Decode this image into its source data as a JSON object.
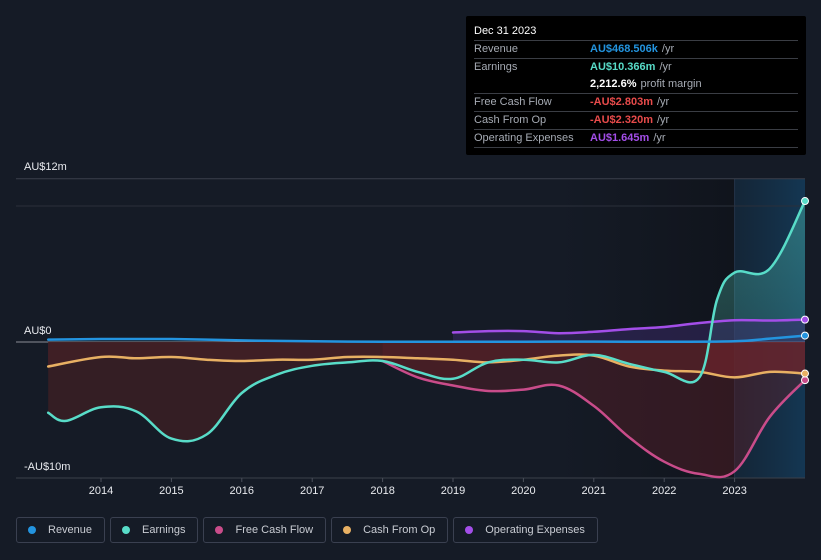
{
  "tooltip": {
    "date": "Dec 31 2023",
    "rows": [
      {
        "label": "Revenue",
        "value": "AU$468.506k",
        "unit": "/yr",
        "color": "#2394df"
      },
      {
        "label": "Earnings",
        "value": "AU$10.366m",
        "unit": "/yr",
        "color": "#58dcc8"
      },
      {
        "label": "",
        "value": "2,212.6%",
        "unit": "profit margin",
        "color": "#ffffff"
      },
      {
        "label": "Free Cash Flow",
        "value": "-AU$2.803m",
        "unit": "/yr",
        "color": "#e84b4b"
      },
      {
        "label": "Cash From Op",
        "value": "-AU$2.320m",
        "unit": "/yr",
        "color": "#e84b4b"
      },
      {
        "label": "Operating Expenses",
        "value": "AU$1.645m",
        "unit": "/yr",
        "color": "#a34ee8"
      }
    ]
  },
  "legend": [
    {
      "label": "Revenue",
      "color": "#2394df"
    },
    {
      "label": "Earnings",
      "color": "#58dcc8"
    },
    {
      "label": "Free Cash Flow",
      "color": "#c94c8a"
    },
    {
      "label": "Cash From Op",
      "color": "#e8b063"
    },
    {
      "label": "Operating Expenses",
      "color": "#a34ee8"
    }
  ],
  "chart_data": {
    "type": "line",
    "title": "",
    "xlabel": "",
    "ylabel": "",
    "currency": "AU$",
    "units": "millions",
    "ylim": [
      -10,
      12
    ],
    "xlim": [
      2013.25,
      2024.0
    ],
    "y_tick_labels": [
      {
        "value": 12,
        "label": "AU$12m"
      },
      {
        "value": 0,
        "label": "AU$0"
      },
      {
        "value": -10,
        "label": "-AU$10m"
      }
    ],
    "x_tick_labels": [
      "2014",
      "2015",
      "2016",
      "2017",
      "2018",
      "2019",
      "2020",
      "2021",
      "2022",
      "2023"
    ],
    "x_ticks": [
      2014,
      2015,
      2016,
      2017,
      2018,
      2019,
      2020,
      2021,
      2022,
      2023
    ],
    "highlight_region_start": 2023.0,
    "grid": true,
    "legend_position": "bottom-left",
    "series": [
      {
        "name": "Revenue",
        "color": "#2394df",
        "x": [
          2013.25,
          2014,
          2015,
          2016,
          2017,
          2018,
          2019,
          2020,
          2021,
          2022,
          2023,
          2023.5,
          2024.0
        ],
        "y": [
          0.18,
          0.22,
          0.22,
          0.12,
          0.05,
          0.02,
          0.02,
          0.02,
          0.03,
          0.02,
          0.05,
          0.25,
          0.47
        ]
      },
      {
        "name": "Earnings",
        "color": "#58dcc8",
        "x": [
          2013.25,
          2013.5,
          2014,
          2014.5,
          2015,
          2015.5,
          2016,
          2016.5,
          2017,
          2017.5,
          2018,
          2018.5,
          2019,
          2019.5,
          2020,
          2020.5,
          2021,
          2021.5,
          2022,
          2022.5,
          2022.75,
          2023,
          2023.5,
          2024.0
        ],
        "y": [
          -5.2,
          -5.8,
          -4.8,
          -5.1,
          -7.1,
          -6.8,
          -3.75,
          -2.4,
          -1.75,
          -1.5,
          -1.4,
          -2.2,
          -2.7,
          -1.5,
          -1.3,
          -1.5,
          -0.95,
          -1.6,
          -2.2,
          -2.6,
          3.1,
          5.1,
          5.4,
          10.366
        ]
      },
      {
        "name": "Free Cash Flow",
        "color": "#c94c8a",
        "x": [
          2018,
          2018.5,
          2019,
          2019.5,
          2020,
          2020.5,
          2021,
          2021.5,
          2022,
          2022.5,
          2023,
          2023.5,
          2024.0
        ],
        "y": [
          -1.4,
          -2.6,
          -3.2,
          -3.6,
          -3.5,
          -3.2,
          -4.7,
          -7.0,
          -8.8,
          -9.7,
          -9.5,
          -5.5,
          -2.803
        ]
      },
      {
        "name": "Cash From Op",
        "color": "#e8b063",
        "x": [
          2013.25,
          2014,
          2014.5,
          2015,
          2015.5,
          2016,
          2016.5,
          2017,
          2017.5,
          2018,
          2018.5,
          2019,
          2019.5,
          2020,
          2020.5,
          2021,
          2021.5,
          2022,
          2022.5,
          2023,
          2023.5,
          2024.0
        ],
        "y": [
          -1.8,
          -1.1,
          -1.2,
          -1.1,
          -1.3,
          -1.4,
          -1.3,
          -1.3,
          -1.1,
          -1.1,
          -1.2,
          -1.3,
          -1.5,
          -1.3,
          -1.0,
          -1.0,
          -1.8,
          -2.1,
          -2.2,
          -2.6,
          -2.2,
          -2.32
        ]
      },
      {
        "name": "Operating Expenses",
        "color": "#a34ee8",
        "x": [
          2019,
          2019.5,
          2020,
          2020.5,
          2021,
          2021.5,
          2022,
          2022.5,
          2023,
          2023.5,
          2024.0
        ],
        "y": [
          0.7,
          0.8,
          0.8,
          0.65,
          0.75,
          0.95,
          1.1,
          1.4,
          1.6,
          1.58,
          1.645
        ]
      }
    ]
  }
}
